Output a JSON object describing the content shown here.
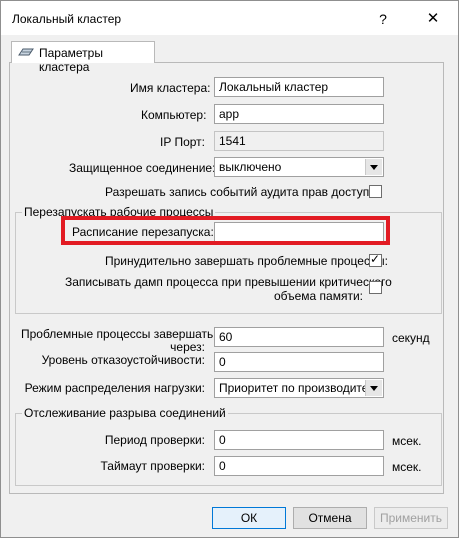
{
  "window": {
    "title": "Локальный кластер",
    "help": "?",
    "close": "✕"
  },
  "tab": {
    "label": "Параметры кластера"
  },
  "fields": {
    "cluster_name": {
      "label": "Имя кластера:",
      "value": "Локальный кластер"
    },
    "computer": {
      "label": "Компьютер:",
      "value": "app"
    },
    "ip_port": {
      "label": "IP Порт:",
      "value": "1541"
    },
    "secure_connection": {
      "label": "Защищенное соединение:",
      "value": "выключено"
    },
    "audit_log": {
      "label": "Разрешать запись событий аудита прав доступа:",
      "checked": false
    }
  },
  "restart_group": {
    "title": "Перезапускать рабочие процессы",
    "schedule_label": "Расписание перезапуска:",
    "schedule_value": "",
    "force_kill_label": "Принудительно завершать проблемные процессы:",
    "force_kill_checked": true,
    "dump_label_line1": "Записывать дамп процесса при превышении критического",
    "dump_label_line2": "объема памяти:",
    "dump_checked": false
  },
  "process": {
    "kill_label_line1": "Проблемные процессы завершать",
    "kill_label_line2": "через:",
    "kill_value": "60",
    "kill_unit": "секунд",
    "fault_label": "Уровень отказоустойчивости:",
    "fault_value": "0",
    "load_label": "Режим распределения нагрузки:",
    "load_value": "Приоритет по производитель"
  },
  "monitor_group": {
    "title": "Отслеживание разрыва соединений",
    "period_label": "Период проверки:",
    "period_value": "0",
    "period_unit": "мсек.",
    "timeout_label": "Таймаут проверки:",
    "timeout_value": "0",
    "timeout_unit": "мсек."
  },
  "buttons": {
    "ok": "ОК",
    "cancel": "Отмена",
    "apply": "Применить"
  },
  "colors": {
    "highlight": "#e21b23",
    "default_button": "#0078d7"
  }
}
